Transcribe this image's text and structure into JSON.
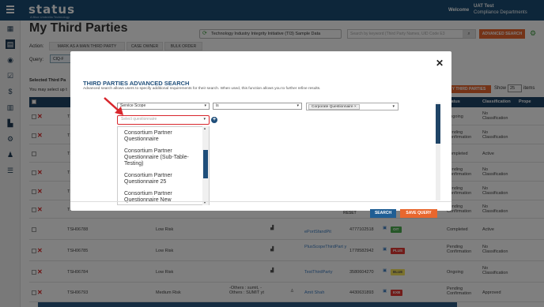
{
  "header": {
    "logo": "status",
    "logo_sub": "A Blue Umbrella Technology",
    "welcome": "Welcome",
    "user_name": "UAT Test",
    "user_dept": "Compliance Departments"
  },
  "sidebar": {
    "icons": [
      "table-icon",
      "list-icon",
      "eye-icon",
      "checklist-icon",
      "dollar-icon",
      "report-icon",
      "chart-icon",
      "gear-icon",
      "user-check-icon",
      "user-list-icon"
    ]
  },
  "page": {
    "title": "My Third Parties",
    "sample_data": "Technology Industry Integrity Initiative (TI3) Sample Data",
    "keyword_placeholder": "Search by keyword (Third Party Names, UID Code E3",
    "advanced_search": "ADVANCED SEARCH",
    "action_label": "Action:",
    "action_tabs": [
      "MARK AS A MAIN THIRD PARTY",
      "CASE OWNER",
      "BULK ORDER"
    ],
    "query_label": "Query:",
    "query_chip": "CIQ-F",
    "selected_text": "Selected Third Pa",
    "may_select_text": "You may select up t",
    "right_button": "Y THIRD PARTIES",
    "show_label": "Show",
    "show_value": "25",
    "items_label": "items"
  },
  "table": {
    "headers": [
      "Status",
      "Classification",
      "Prope"
    ],
    "rows": [
      {
        "id": "TSH06",
        "risk": "",
        "status": "Ongoing",
        "classification": "No Classification"
      },
      {
        "id": "TSH06",
        "risk": "",
        "status": "Pending Confirmation",
        "classification": "No Classification"
      },
      {
        "id": "TSH06",
        "risk": "",
        "status": "Completed",
        "classification": "Active"
      },
      {
        "id": "TSH06",
        "risk": "",
        "status": "Pending Confirmation",
        "classification": "No Classification"
      },
      {
        "id": "TSH06",
        "risk": "",
        "status": "Pending Confirmation",
        "classification": "No Classification"
      },
      {
        "id": "TSH06",
        "risk": "",
        "status": "Pending Confirmation",
        "classification": "No Classification"
      },
      {
        "id": "TSH06788",
        "risk": "Low Risk",
        "name": "ePortSfandPit",
        "phone": "4777102518",
        "tag": "OIT",
        "status": "Completed",
        "classification": "Active"
      },
      {
        "id": "TSH06785",
        "risk": "Low Risk",
        "name": "PlusScopeThirdPart y",
        "phone": "1778582942",
        "tag": "PLUS",
        "status": "Pending Confirmation",
        "classification": "No Classification"
      },
      {
        "id": "TSH06784",
        "risk": "Low Risk",
        "name": "TestThirdParty",
        "phone": "3580604270",
        "tag": "BLUE",
        "status": "Ongoing",
        "classification": "No Classification"
      },
      {
        "id": "TSH06793",
        "risk": "Medium Risk",
        "owners": "-Others : sumit, -Others : SUMIT yt",
        "name": "Amit Shah",
        "phone": "4430631893",
        "tag": "EXB",
        "status": "Pending Confirmation",
        "classification": "Approved"
      }
    ]
  },
  "modal": {
    "title": "THIRD PARTIES ADVANCED SEARCH",
    "description": "Advanced search allows users to specify additional requirements for their search. When used, this function allows you to further refine results.",
    "field_select": "Service Scope",
    "operator_select": "is",
    "value_tag": "Corporate Questionnaire",
    "questionnaire_placeholder": "Select questionnaire",
    "dropdown_items": [
      "Consortium Partner Questionnaire",
      "Consortium Partner Questionnaire (Sub-Table-Testing)",
      "Consortium Partner Questionnaire 25",
      "Consortium Partner Questionnaire New"
    ],
    "reset_label": "RESET",
    "search_label": "SEARCH",
    "save_query_label": "SAVE QUERY"
  },
  "colors": {
    "header_bg": "#1a4d75",
    "accent_orange": "#e8672e",
    "primary_blue": "#1f5e94",
    "highlight_red": "#d8262c"
  }
}
